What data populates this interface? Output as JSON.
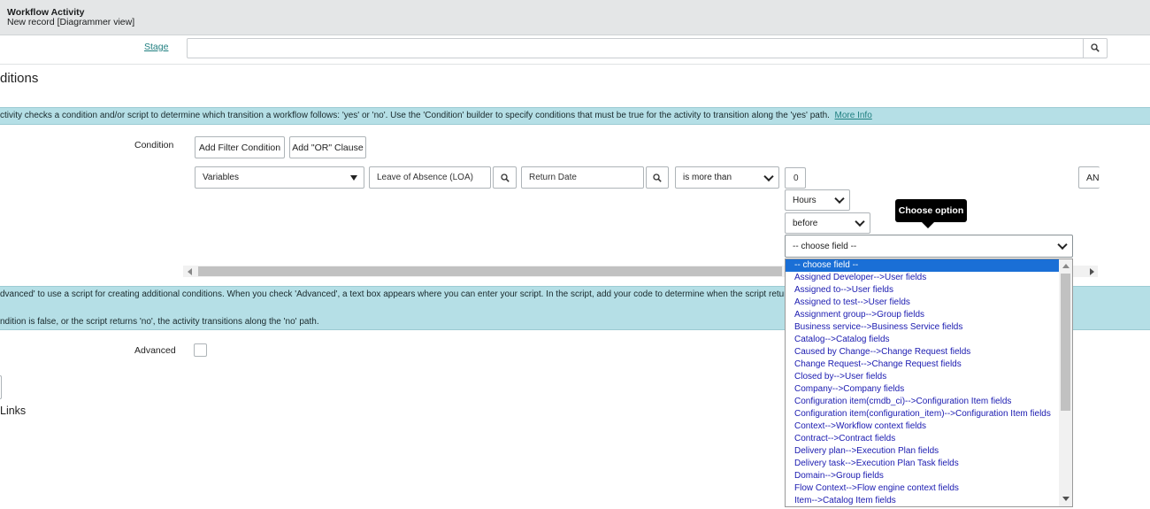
{
  "header": {
    "title": "Workflow Activity",
    "subtitle": "New record [Diagrammer view]"
  },
  "stage": {
    "label": "Stage",
    "value": ""
  },
  "section": {
    "title": "ditions"
  },
  "info_top": {
    "text": "ctivity checks a condition and/or script to determine which transition a workflow follows: 'yes' or 'no'. Use the 'Condition' builder to specify conditions that must be true for the activity to transition along the 'yes' path.",
    "link": "More Info"
  },
  "condition": {
    "label": "Condition",
    "add_filter_button": "Add Filter Condition",
    "add_or_button": "Add \"OR\" Clause",
    "field_select": "Variables",
    "ref1": "Leave of Absence (LOA)",
    "ref2": "Return Date",
    "operator": "is more than",
    "amount": "0",
    "unit": "Hours",
    "relation": "before",
    "choose_field": "-- choose field --",
    "and_button": "AN"
  },
  "tooltip": "Choose option",
  "dropdown": {
    "options": [
      "-- choose field --",
      "Assigned Developer-->User fields",
      "Assigned to-->User fields",
      "Assigned to test-->User fields",
      "Assignment group-->Group fields",
      "Business service-->Business Service fields",
      "Catalog-->Catalog fields",
      "Caused by Change-->Change Request fields",
      "Change Request-->Change Request fields",
      "Closed by-->User fields",
      "Company-->Company fields",
      "Configuration item(cmdb_ci)-->Configuration Item fields",
      "Configuration item(configuration_item)-->Configuration Item fields",
      "Context-->Workflow context fields",
      "Contract-->Contract fields",
      "Delivery plan-->Execution Plan fields",
      "Delivery task-->Execution Plan Task fields",
      "Domain-->Group fields",
      "Flow Context-->Flow engine context fields",
      "Item-->Catalog Item fields"
    ]
  },
  "info_bottom": {
    "line1": "dvanced' to use a script for creating additional conditions. When you check 'Advanced', a text box appears where you can enter your script. In the script, add your code to determine when the script returns 'ye",
    "line2": "ndition is false, or the script returns 'no', the activity transitions along the 'no' path."
  },
  "advanced": {
    "label": "Advanced",
    "checked": false
  },
  "links": {
    "title": "Links"
  }
}
